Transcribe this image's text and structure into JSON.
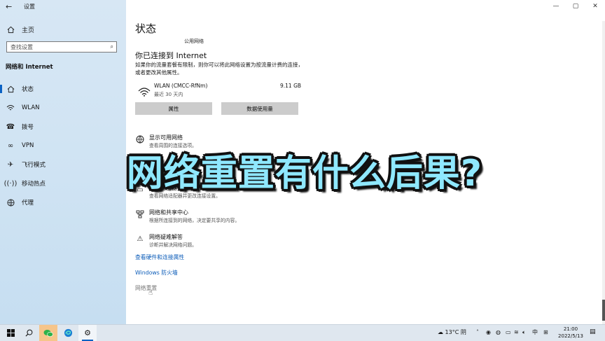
{
  "window": {
    "app_title": "设置",
    "back_glyph": "←",
    "controls": [
      "—",
      "▢",
      "✕"
    ]
  },
  "sidebar": {
    "home": "主页",
    "search_placeholder": "查找设置",
    "section": "网络和 Internet",
    "items": [
      {
        "label": "状态",
        "icon": "home-status-icon",
        "active": true
      },
      {
        "label": "WLAN",
        "icon": "wifi-icon"
      },
      {
        "label": "拨号",
        "icon": "dialup-icon"
      },
      {
        "label": "VPN",
        "icon": "vpn-icon"
      },
      {
        "label": "飞行模式",
        "icon": "airplane-icon"
      },
      {
        "label": "移动热点",
        "icon": "hotspot-icon"
      },
      {
        "label": "代理",
        "icon": "globe-icon"
      }
    ]
  },
  "main": {
    "title": "状态",
    "network_type": "公用网络",
    "connected_heading": "你已连接到 Internet",
    "description": "如果你的流量套餐有限制，则你可以将此网络设置为按流量计费的连接，或者更改其他属性。",
    "wlan": {
      "name": "WLAN (CMCC-RfNm)",
      "sub": "最近 30 天内",
      "data_used": "9.11 GB"
    },
    "buttons": {
      "properties": "属性",
      "data_usage": "数据使用量"
    },
    "rows": [
      {
        "title": "显示可用网络",
        "sub": "查看周围的连接选项。"
      },
      {
        "title": "更改适配器选项",
        "sub": "查看网络适配器并更改连接设置。"
      },
      {
        "title": "网络和共享中心",
        "sub": "根据所连接到的网络，决定要共享的内容。"
      },
      {
        "title": "网络疑难解答",
        "sub": "诊断并解决网络问题。"
      }
    ],
    "links": {
      "hardware": "查看硬件和连接属性",
      "firewall": "Windows 防火墙",
      "reset": "网络重置"
    }
  },
  "overlay_text": "网络重置有什么后果?",
  "taskbar": {
    "weather": "13°C 阴",
    "ime": "中",
    "time": "21:00",
    "date": "2022/5/13"
  },
  "colors": {
    "accent": "#0a62c4",
    "link": "#0a5bb8",
    "overlay_fill": "#8fe8ff"
  }
}
